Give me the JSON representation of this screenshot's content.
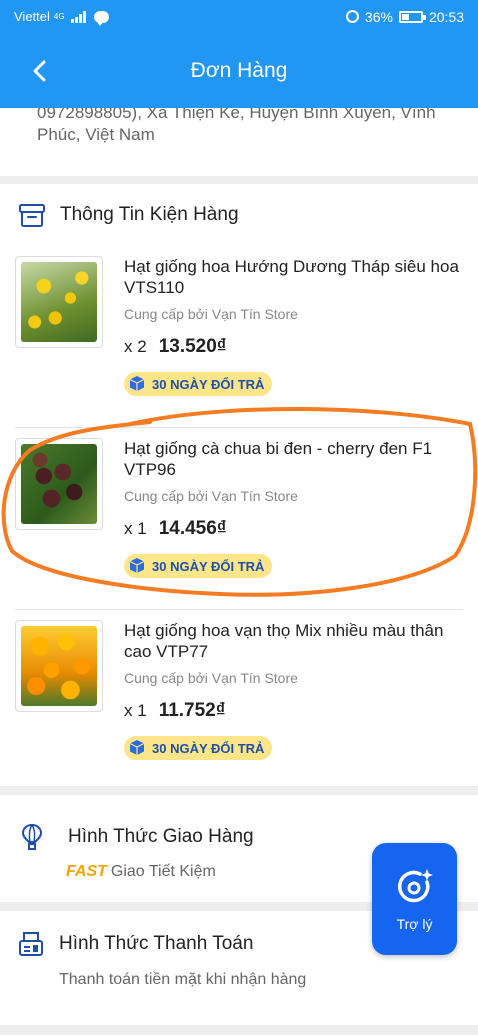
{
  "status_bar": {
    "carrier": "Viettel",
    "network": "4G",
    "battery": "36%",
    "time": "20:53"
  },
  "header": {
    "title": "Đơn Hàng"
  },
  "address": {
    "text": "0972898805), Xã Thiện Kế, Huyện Bình Xuyên, Vĩnh Phúc, Việt Nam"
  },
  "package_section": {
    "title": "Thông Tin Kiện Hàng",
    "products": [
      {
        "name": "Hạt giống hoa Hướng Dương Tháp siêu hoa VTS110",
        "seller": "Cung cấp bởi Vạn Tín Store",
        "qty": "x 2",
        "price": "13.520₫",
        "badge": "30 NGÀY ĐỔI TRẢ",
        "image": "sunflower"
      },
      {
        "name": "Hạt giống cà chua bi đen - cherry đen F1 VTP96",
        "seller": "Cung cấp bởi Vạn Tín Store",
        "qty": "x 1",
        "price": "14.456₫",
        "badge": "30 NGÀY ĐỔI TRẢ",
        "image": "black-cherry-tomato"
      },
      {
        "name": "Hạt giống hoa vạn thọ Mix nhiều màu thân cao VTP77",
        "seller": "Cung cấp bởi Vạn Tín Store",
        "qty": "x 1",
        "price": "11.752₫",
        "badge": "30 NGÀY ĐỔI TRẢ",
        "image": "marigold"
      }
    ]
  },
  "shipping": {
    "title": "Hình Thức Giao Hàng",
    "tag": "FAST",
    "method": "Giao Tiết Kiệm"
  },
  "payment": {
    "title": "Hình Thức Thanh Toán",
    "method": "Thanh toán tiền mặt khi nhận hàng"
  },
  "assistant": {
    "label": "Trợ lý"
  },
  "colors": {
    "primary": "#2196f3",
    "assistant": "#1565f0",
    "badge_bg": "#fde68a",
    "badge_text": "#1f4fa8",
    "fast": "#f5a400",
    "annotation": "#f57c22"
  }
}
